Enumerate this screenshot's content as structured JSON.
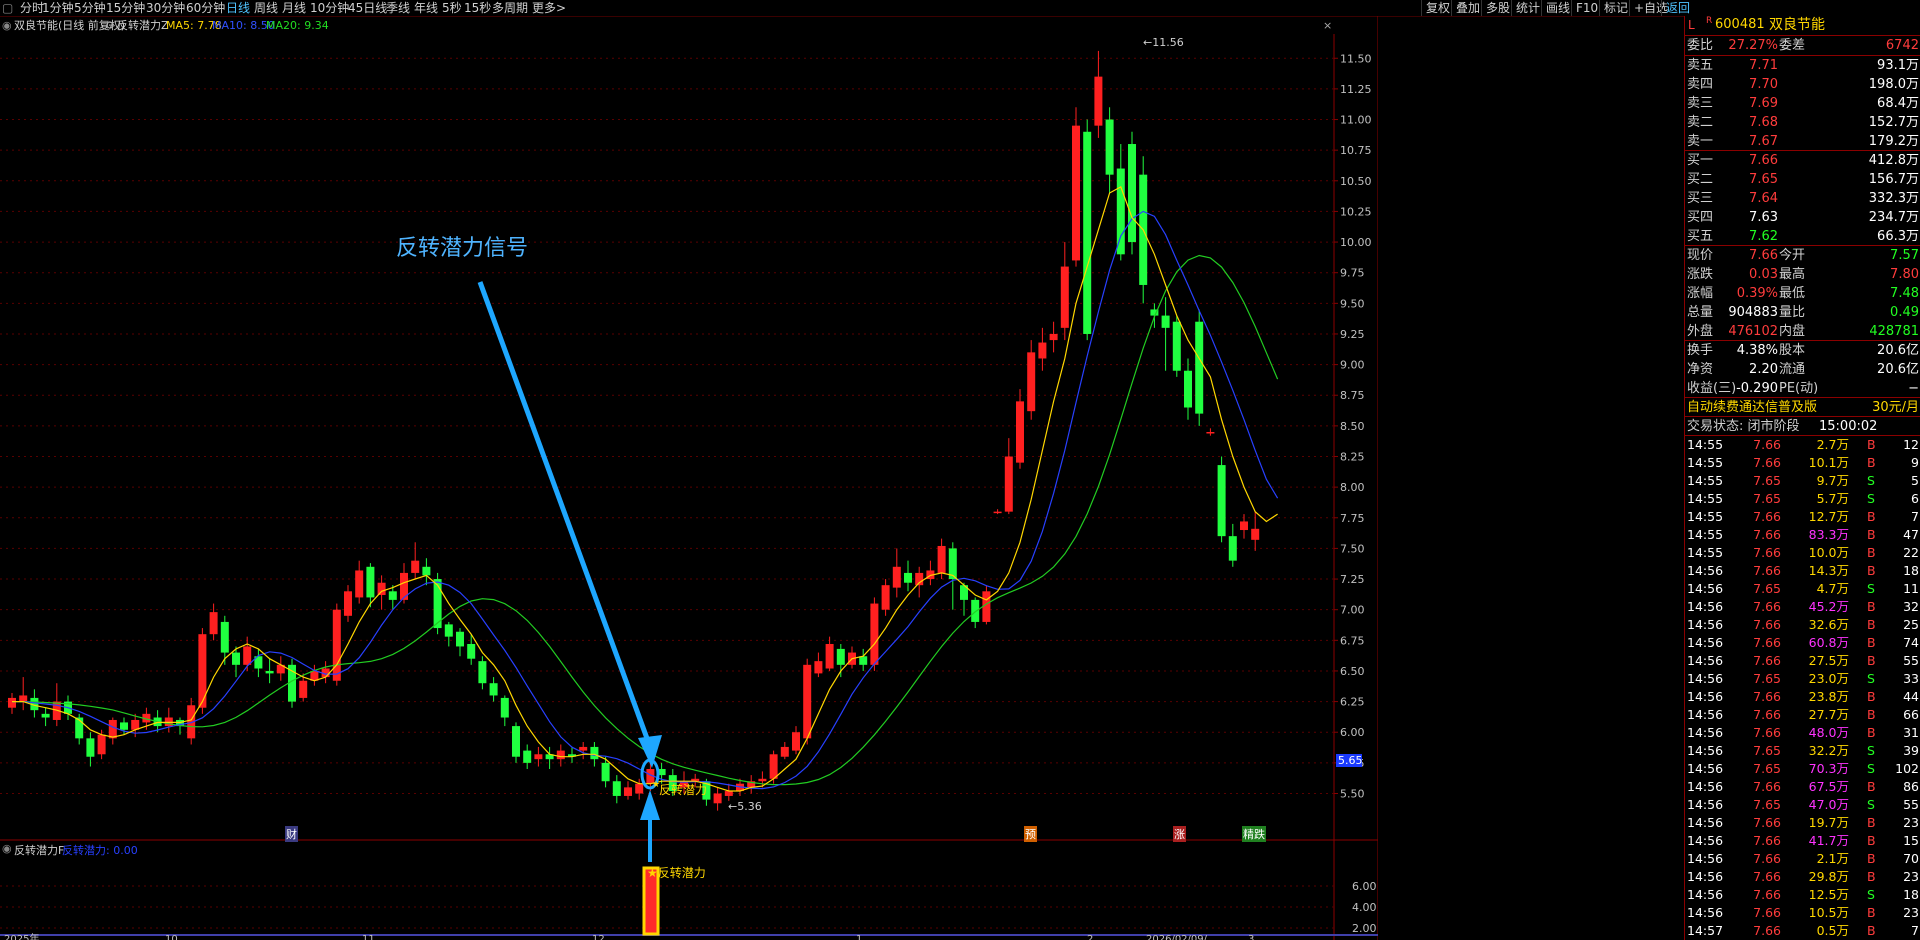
{
  "toolbar": {
    "periods": [
      "分时",
      "1分钟",
      "5分钟",
      "15分钟",
      "30分钟",
      "60分钟",
      "日线",
      "周线",
      "月线",
      "10分钟",
      "45日线",
      "季线",
      "年线",
      "5秒",
      "15秒",
      "多周期",
      "更多>"
    ],
    "active_index": 6,
    "right_buttons": [
      "复权",
      "叠加",
      "多股",
      "统计",
      "画线",
      "F10",
      "标记",
      "+自选",
      "返回"
    ]
  },
  "chart_header": {
    "stock_label": "双良节能(日线 前复权)",
    "indicator_name": "反转潜力Z",
    "ma5": "MA5: 7.78",
    "ma10": "MA10: 8.50",
    "ma20": "MA20: 9.34"
  },
  "annotation": {
    "signal_text": "反转潜力信号",
    "marker_label": "反转潜力",
    "high_label": "11.56",
    "low_label": "5.36"
  },
  "event_markers": [
    "财",
    "预",
    "涨",
    "精跌"
  ],
  "price_axis": [
    "11.50",
    "11.25",
    "11.00",
    "10.75",
    "10.50",
    "10.25",
    "10.00",
    "9.75",
    "9.50",
    "9.25",
    "9.00",
    "8.75",
    "8.50",
    "8.25",
    "8.00",
    "7.75",
    "7.50",
    "7.25",
    "7.00",
    "6.75",
    "6.50",
    "6.25",
    "6.00",
    "5.75",
    "5.50"
  ],
  "cursor_price": "5.65",
  "sub_chart": {
    "name": "反转潜力F",
    "value_label": "反转潜力: 0.00",
    "axis": [
      "6.00",
      "4.00",
      "2.00"
    ],
    "marker_label": "反转潜力"
  },
  "date_axis": [
    "2025年",
    "10",
    "11",
    "12",
    "1",
    "2",
    "2026/02/09/",
    "3"
  ],
  "panel": {
    "code": "600481",
    "name": "双良节能",
    "prefix": "L",
    "weibi_label": "委比",
    "weibi": "27.27%",
    "weicha_label": "委差",
    "weicha": "6742",
    "sells": [
      {
        "label": "卖五",
        "price": "7.71",
        "vol": "93.1万"
      },
      {
        "label": "卖四",
        "price": "7.70",
        "vol": "198.0万"
      },
      {
        "label": "卖三",
        "price": "7.69",
        "vol": "68.4万"
      },
      {
        "label": "卖二",
        "price": "7.68",
        "vol": "152.7万"
      },
      {
        "label": "卖一",
        "price": "7.67",
        "vol": "179.2万"
      }
    ],
    "buys": [
      {
        "label": "买一",
        "price": "7.66",
        "vol": "412.8万"
      },
      {
        "label": "买二",
        "price": "7.65",
        "vol": "156.7万"
      },
      {
        "label": "买三",
        "price": "7.64",
        "vol": "332.3万"
      },
      {
        "label": "买四",
        "price": "7.63",
        "vol": "234.7万"
      },
      {
        "label": "买五",
        "price": "7.62",
        "vol": "66.3万"
      }
    ],
    "quote": [
      {
        "l1": "现价",
        "v1": "7.66",
        "l2": "今开",
        "v2": "7.57"
      },
      {
        "l1": "涨跌",
        "v1": "0.03",
        "l2": "最高",
        "v2": "7.80"
      },
      {
        "l1": "涨幅",
        "v1": "0.39%",
        "l2": "最低",
        "v2": "7.48"
      },
      {
        "l1": "总量",
        "v1": "904883",
        "l2": "量比",
        "v2": "0.49"
      },
      {
        "l1": "外盘",
        "v1": "476102",
        "l2": "内盘",
        "v2": "428781"
      }
    ],
    "fund": [
      {
        "l1": "换手",
        "v1": "4.38%",
        "l2": "股本",
        "v2": "20.6亿"
      },
      {
        "l1": "净资",
        "v1": "2.20",
        "l2": "流通",
        "v2": "20.6亿"
      },
      {
        "l1": "收益(三)",
        "v1": "-0.290",
        "l2": "PE(动)",
        "v2": "−"
      }
    ],
    "ad_text": "自动续费通达信普及版",
    "ad_price": "30元/月",
    "status_label": "交易状态: 闭市阶段",
    "status_time": "15:00:02",
    "ticks": [
      [
        "14:55",
        "7.66",
        "2.7万",
        "B",
        "12"
      ],
      [
        "14:55",
        "7.66",
        "10.1万",
        "B",
        "9"
      ],
      [
        "14:55",
        "7.65",
        "9.7万",
        "S",
        "5"
      ],
      [
        "14:55",
        "7.65",
        "5.7万",
        "S",
        "6"
      ],
      [
        "14:55",
        "7.66",
        "12.7万",
        "B",
        "7"
      ],
      [
        "14:55",
        "7.66",
        "83.3万",
        "B",
        "47"
      ],
      [
        "14:55",
        "7.66",
        "10.0万",
        "B",
        "22"
      ],
      [
        "14:56",
        "7.66",
        "14.3万",
        "B",
        "18"
      ],
      [
        "14:56",
        "7.65",
        "4.7万",
        "S",
        "11"
      ],
      [
        "14:56",
        "7.66",
        "45.2万",
        "B",
        "32"
      ],
      [
        "14:56",
        "7.66",
        "32.6万",
        "B",
        "25"
      ],
      [
        "14:56",
        "7.66",
        "60.8万",
        "B",
        "74"
      ],
      [
        "14:56",
        "7.66",
        "27.5万",
        "B",
        "55"
      ],
      [
        "14:56",
        "7.65",
        "23.0万",
        "S",
        "33"
      ],
      [
        "14:56",
        "7.66",
        "23.8万",
        "B",
        "44"
      ],
      [
        "14:56",
        "7.66",
        "27.7万",
        "B",
        "66"
      ],
      [
        "14:56",
        "7.66",
        "48.0万",
        "B",
        "31"
      ],
      [
        "14:56",
        "7.65",
        "32.2万",
        "S",
        "39"
      ],
      [
        "14:56",
        "7.65",
        "70.3万",
        "S",
        "102"
      ],
      [
        "14:56",
        "7.66",
        "67.5万",
        "B",
        "86"
      ],
      [
        "14:56",
        "7.65",
        "47.0万",
        "S",
        "55"
      ],
      [
        "14:56",
        "7.66",
        "19.7万",
        "B",
        "23"
      ],
      [
        "14:56",
        "7.66",
        "41.7万",
        "B",
        "15"
      ],
      [
        "14:56",
        "7.66",
        "2.1万",
        "B",
        "70"
      ],
      [
        "14:56",
        "7.66",
        "29.8万",
        "B",
        "23"
      ],
      [
        "14:56",
        "7.66",
        "12.5万",
        "S",
        "18"
      ],
      [
        "14:56",
        "7.66",
        "10.5万",
        "B",
        "23"
      ],
      [
        "14:57",
        "7.66",
        "0.5万",
        "B",
        "7"
      ]
    ]
  },
  "chart_data": {
    "type": "candlestick",
    "ylim": [
      5.3,
      11.6
    ],
    "candles": [
      [
        6.2,
        6.28,
        6.15,
        6.32
      ],
      [
        6.25,
        6.3,
        6.18,
        6.45
      ],
      [
        6.28,
        6.18,
        6.12,
        6.35
      ],
      [
        6.15,
        6.12,
        6.05,
        6.2
      ],
      [
        6.1,
        6.25,
        6.05,
        6.4
      ],
      [
        6.25,
        6.15,
        6.1,
        6.3
      ],
      [
        6.12,
        5.95,
        5.9,
        6.15
      ],
      [
        5.95,
        5.8,
        5.72,
        6.0
      ],
      [
        5.82,
        5.98,
        5.78,
        6.02
      ],
      [
        5.95,
        6.1,
        5.9,
        6.12
      ],
      [
        6.08,
        6.02,
        5.98,
        6.12
      ],
      [
        6.02,
        6.1,
        5.96,
        6.15
      ],
      [
        6.08,
        6.15,
        6.02,
        6.2
      ],
      [
        6.12,
        6.05,
        6.0,
        6.18
      ],
      [
        6.05,
        6.12,
        6.0,
        6.2
      ],
      [
        6.1,
        6.05,
        5.98,
        6.12
      ],
      [
        5.95,
        6.22,
        5.9,
        6.28
      ],
      [
        6.2,
        6.8,
        6.15,
        6.85
      ],
      [
        6.8,
        6.98,
        6.75,
        7.05
      ],
      [
        6.9,
        6.65,
        6.55,
        6.95
      ],
      [
        6.65,
        6.55,
        6.45,
        6.7
      ],
      [
        6.55,
        6.7,
        6.5,
        6.78
      ],
      [
        6.62,
        6.52,
        6.45,
        6.68
      ],
      [
        6.5,
        6.48,
        6.4,
        6.6
      ],
      [
        6.48,
        6.55,
        6.42,
        6.62
      ],
      [
        6.55,
        6.25,
        6.2,
        6.6
      ],
      [
        6.28,
        6.42,
        6.25,
        6.48
      ],
      [
        6.42,
        6.5,
        6.38,
        6.55
      ],
      [
        6.45,
        6.52,
        6.4,
        6.58
      ],
      [
        6.42,
        7.0,
        6.38,
        7.05
      ],
      [
        6.95,
        7.15,
        6.9,
        7.2
      ],
      [
        7.1,
        7.32,
        7.05,
        7.4
      ],
      [
        7.35,
        7.1,
        7.02,
        7.38
      ],
      [
        7.12,
        7.22,
        7.0,
        7.28
      ],
      [
        7.15,
        7.08,
        7.0,
        7.2
      ],
      [
        7.08,
        7.3,
        7.05,
        7.38
      ],
      [
        7.3,
        7.4,
        7.25,
        7.55
      ],
      [
        7.35,
        7.28,
        7.2,
        7.42
      ],
      [
        7.25,
        6.85,
        6.8,
        7.3
      ],
      [
        6.88,
        6.78,
        6.7,
        6.9
      ],
      [
        6.82,
        6.7,
        6.62,
        6.85
      ],
      [
        6.72,
        6.6,
        6.55,
        6.8
      ],
      [
        6.58,
        6.4,
        6.35,
        6.62
      ],
      [
        6.4,
        6.3,
        6.25,
        6.45
      ],
      [
        6.28,
        6.12,
        6.05,
        6.3
      ],
      [
        6.05,
        5.8,
        5.75,
        6.08
      ],
      [
        5.85,
        5.75,
        5.7,
        5.9
      ],
      [
        5.78,
        5.82,
        5.72,
        5.88
      ],
      [
        5.82,
        5.78,
        5.7,
        5.88
      ],
      [
        5.78,
        5.85,
        5.72,
        5.9
      ],
      [
        5.82,
        5.8,
        5.75,
        5.88
      ],
      [
        5.85,
        5.88,
        5.78,
        5.92
      ],
      [
        5.88,
        5.78,
        5.72,
        5.92
      ],
      [
        5.75,
        5.6,
        5.55,
        5.8
      ],
      [
        5.6,
        5.48,
        5.42,
        5.65
      ],
      [
        5.48,
        5.55,
        5.45,
        5.6
      ],
      [
        5.5,
        5.58,
        5.45,
        5.62
      ],
      [
        5.58,
        5.7,
        5.52,
        5.75
      ],
      [
        5.7,
        5.65,
        5.58,
        5.75
      ],
      [
        5.65,
        5.52,
        5.48,
        5.7
      ],
      [
        5.55,
        5.6,
        5.5,
        5.68
      ],
      [
        5.6,
        5.62,
        5.55,
        5.66
      ],
      [
        5.6,
        5.45,
        5.4,
        5.62
      ],
      [
        5.42,
        5.5,
        5.36,
        5.55
      ],
      [
        5.48,
        5.52,
        5.44,
        5.58
      ],
      [
        5.52,
        5.58,
        5.48,
        5.62
      ],
      [
        5.55,
        5.6,
        5.5,
        5.65
      ],
      [
        5.6,
        5.62,
        5.55,
        5.68
      ],
      [
        5.62,
        5.82,
        5.58,
        5.85
      ],
      [
        5.8,
        5.88,
        5.78,
        5.92
      ],
      [
        5.85,
        6.0,
        5.82,
        6.05
      ],
      [
        5.95,
        6.55,
        5.9,
        6.6
      ],
      [
        6.48,
        6.58,
        6.45,
        6.65
      ],
      [
        6.52,
        6.72,
        6.5,
        6.78
      ],
      [
        6.68,
        6.55,
        6.45,
        6.72
      ],
      [
        6.55,
        6.65,
        6.52,
        6.7
      ],
      [
        6.62,
        6.55,
        6.5,
        6.68
      ],
      [
        6.55,
        7.05,
        6.5,
        7.1
      ],
      [
        7.0,
        7.2,
        6.95,
        7.25
      ],
      [
        7.18,
        7.35,
        7.1,
        7.5
      ],
      [
        7.3,
        7.22,
        7.15,
        7.4
      ],
      [
        7.2,
        7.3,
        7.1,
        7.35
      ],
      [
        7.25,
        7.32,
        7.2,
        7.4
      ],
      [
        7.3,
        7.52,
        7.25,
        7.58
      ],
      [
        7.5,
        7.25,
        7.0,
        7.55
      ],
      [
        7.2,
        7.08,
        6.95,
        7.22
      ],
      [
        7.08,
        6.9,
        6.85,
        7.1
      ],
      [
        6.9,
        7.15,
        6.88,
        7.2
      ],
      [
        7.8,
        7.8,
        7.78,
        7.82
      ],
      [
        7.8,
        8.25,
        7.78,
        8.4
      ],
      [
        8.2,
        8.7,
        8.15,
        8.8
      ],
      [
        8.62,
        9.1,
        8.55,
        9.2
      ],
      [
        9.05,
        9.18,
        8.95,
        9.3
      ],
      [
        9.2,
        9.25,
        9.1,
        9.35
      ],
      [
        9.3,
        9.8,
        9.2,
        10.0
      ],
      [
        9.85,
        10.95,
        9.8,
        11.1
      ],
      [
        10.9,
        9.25,
        9.2,
        11.0
      ],
      [
        10.95,
        11.35,
        10.85,
        11.56
      ],
      [
        11.0,
        10.55,
        10.4,
        11.1
      ],
      [
        10.6,
        9.9,
        9.85,
        10.8
      ],
      [
        10.8,
        10.0,
        9.9,
        10.9
      ],
      [
        10.55,
        9.65,
        9.5,
        10.7
      ],
      [
        9.45,
        9.4,
        9.3,
        9.5
      ],
      [
        9.4,
        9.3,
        8.95,
        9.55
      ],
      [
        9.35,
        8.95,
        8.9,
        9.4
      ],
      [
        8.95,
        8.65,
        8.55,
        9.05
      ],
      [
        9.35,
        8.6,
        8.5,
        9.45
      ],
      [
        8.45,
        8.45,
        8.42,
        8.48
      ],
      [
        8.18,
        7.6,
        7.55,
        8.25
      ],
      [
        7.6,
        7.4,
        7.35,
        7.7
      ],
      [
        7.65,
        7.72,
        7.58,
        7.78
      ],
      [
        7.57,
        7.66,
        7.48,
        7.8
      ]
    ],
    "ma5": [
      6.25,
      6.25,
      6.22,
      6.2,
      6.18,
      6.15,
      6.1,
      6.02,
      5.98,
      5.96,
      5.98,
      6.02,
      6.05,
      6.08,
      6.08,
      6.08,
      6.1,
      6.25,
      6.45,
      6.6,
      6.68,
      6.72,
      6.68,
      6.6,
      6.55,
      6.5,
      6.45,
      6.42,
      6.45,
      6.55,
      6.72,
      6.9,
      7.05,
      7.15,
      7.18,
      7.22,
      7.25,
      7.28,
      7.2,
      7.05,
      6.92,
      6.8,
      6.65,
      6.55,
      6.42,
      6.22,
      6.05,
      5.92,
      5.82,
      5.8,
      5.8,
      5.82,
      5.82,
      5.78,
      5.7,
      5.62,
      5.58,
      5.58,
      5.6,
      5.6,
      5.6,
      5.6,
      5.58,
      5.55,
      5.52,
      5.52,
      5.55,
      5.56,
      5.62,
      5.7,
      5.78,
      5.95,
      6.15,
      6.35,
      6.5,
      6.6,
      6.62,
      6.72,
      6.85,
      7.0,
      7.12,
      7.22,
      7.28,
      7.3,
      7.28,
      7.2,
      7.12,
      7.08,
      7.15,
      7.3,
      7.55,
      7.9,
      8.3,
      8.7,
      9.05,
      9.5,
      9.8,
      10.1,
      10.4,
      10.45,
      10.2,
      10.1,
      9.9,
      9.65,
      9.4,
      9.2,
      9.05,
      8.9,
      8.55,
      8.25,
      8.0,
      7.8,
      7.72,
      7.78
    ]
  }
}
